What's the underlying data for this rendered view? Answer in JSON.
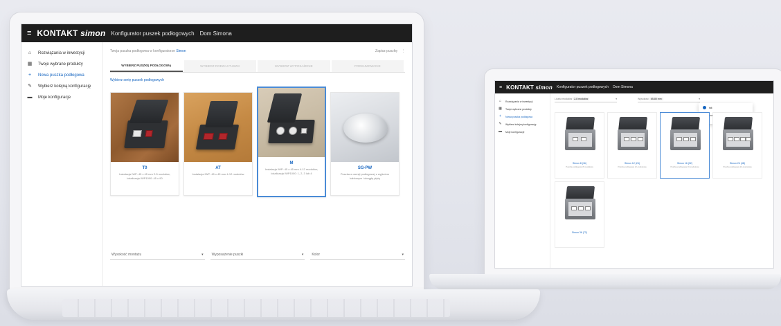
{
  "app": {
    "brand_prefix": "KONTAKT",
    "brand_suffix": "simon",
    "title": "Konfigurator puszek podłogowych",
    "user": "Dom Simona",
    "menu_icon": "≡"
  },
  "sidebar": {
    "items": [
      {
        "label": "Rozwiązania w inwestycji",
        "icon": "home-icon"
      },
      {
        "label": "Twoje wybrane produkty",
        "icon": "grid-icon"
      },
      {
        "label": "Nowa puszka podłogowa",
        "icon": "plus-icon"
      },
      {
        "label": "Wybierz kolejną konfigurację",
        "icon": "edit-icon"
      },
      {
        "label": "Moje konfiguracje",
        "icon": "folder-icon"
      }
    ],
    "active_index": 2
  },
  "main": {
    "hint_text": "Twoja puszka podłogowa w konfiguratorze",
    "hint_link": "Simon",
    "right_text": "Zapisz puszkę",
    "steps": [
      "WYBIERZ PUSZKĘ PODŁOGOWĄ",
      "WYBIERZ RODZAJ PUSZKI",
      "WYBIERZ WYPOSAŻENIE",
      "PODSUMOWANIE"
    ],
    "active_step": 0,
    "choose_label": "Wybierz serię puszek podłogowych",
    "cards": [
      {
        "name": "T0",
        "desc": "Instalacja IWP: 45 x 45 mm 2-5 modułów; lokalizacja IWP1000: 45 x 90"
      },
      {
        "name": "AT",
        "desc": "Instalacja IWP: 45 x 45 mm 4-12 modułów"
      },
      {
        "name": "M",
        "desc": "Instalacja IWP: 45 x 45 mm 4-12 modułów; lokalizacja IWP1000: 1, 2, 3 lub 4"
      },
      {
        "name": "SG-PW",
        "desc": "Puszka w wersji podłogowej z wyjściem kablowym i okrągłą płytą"
      }
    ],
    "selected_card": 2,
    "selects": [
      {
        "label": "Wysokość montażu"
      },
      {
        "label": "Wyposażenie puszki"
      },
      {
        "label": "Kolor"
      }
    ]
  },
  "secondary": {
    "filters": [
      {
        "label": "Liczba modułów",
        "value": "2-8 modułów"
      },
      {
        "label": "Wysokość",
        "value": "65-80 mm"
      }
    ],
    "dropdown_options": [
      {
        "label": "tak",
        "selected": true
      },
      {
        "label": "puste",
        "selected": false
      }
    ],
    "cards": [
      {
        "name": "Simon 8 (16)",
        "desc": "Puszka podłogowa 8-modułowa"
      },
      {
        "name": "Simon 12 (24)",
        "desc": "Puszka podłogowa 12-modułowa"
      },
      {
        "name": "Simon 16 (32)",
        "desc": "Puszka podłogowa 16-modułowa"
      },
      {
        "name": "Simon 24 (48)",
        "desc": "Puszka podłogowa 24-modułowa"
      },
      {
        "name": "Simon 36 (72)",
        "desc": ""
      }
    ],
    "selected_card": 2
  },
  "colors": {
    "appbar": "#1e1e1e",
    "accent": "#1565c0",
    "selected_border": "#4a8bd6"
  }
}
